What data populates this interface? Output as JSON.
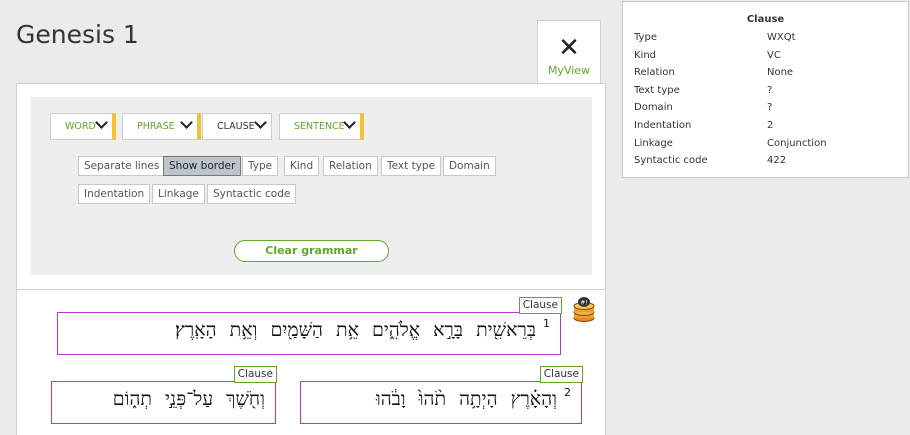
{
  "page": {
    "title": "Genesis 1"
  },
  "myview": {
    "label": "MyView"
  },
  "grammar": {
    "dropdowns": [
      {
        "label": "WORD"
      },
      {
        "label": "PHRASE"
      },
      {
        "label": "CLAUSE"
      },
      {
        "label": "SENTENCE"
      }
    ],
    "options_row1": [
      "Separate lines",
      "Show border",
      "Type",
      "Kind",
      "Relation",
      "Text type",
      "Domain"
    ],
    "options_row2": [
      "Indentation",
      "Linkage",
      "Syntactic code"
    ],
    "selected_option": "Show border",
    "clear_label": "Clear grammar"
  },
  "text": {
    "clauses": [
      {
        "label": "Clause",
        "verse": "1",
        "hebrew": "בְּרֵאשִׁ֖ית בָּרָ֣א אֱלֹהִ֑ים אֵ֥ת הַשָּׁמַ֖יִם וְאֵ֥ת הָאָֽרֶץ׃"
      },
      {
        "label": "Clause",
        "verse": "2",
        "hebrew": "וְהָאָ֗רֶץ הָיְתָ֥ה תֹ֨הוּ֙ וָבֹ֔הוּ"
      },
      {
        "label": "Clause",
        "verse": "",
        "hebrew": "וְחֹ֖שֶׁךְ עַל־פְּנֵ֣י תְה֑וֹם"
      }
    ]
  },
  "tooltip": {
    "title": "Clause",
    "rows": [
      {
        "key": "Type",
        "value": "WXQt"
      },
      {
        "key": "Kind",
        "value": "VC"
      },
      {
        "key": "Relation",
        "value": "None"
      },
      {
        "key": "Text type",
        "value": "?"
      },
      {
        "key": "Domain",
        "value": "?"
      },
      {
        "key": "Indentation",
        "value": "2"
      },
      {
        "key": "Linkage",
        "value": "Conjunction"
      },
      {
        "key": "Syntactic code",
        "value": "422"
      }
    ]
  },
  "colors": {
    "accent": "#5fa82c",
    "clause_border": "#b23cc8",
    "dropdown_edge": "#f1c232"
  }
}
